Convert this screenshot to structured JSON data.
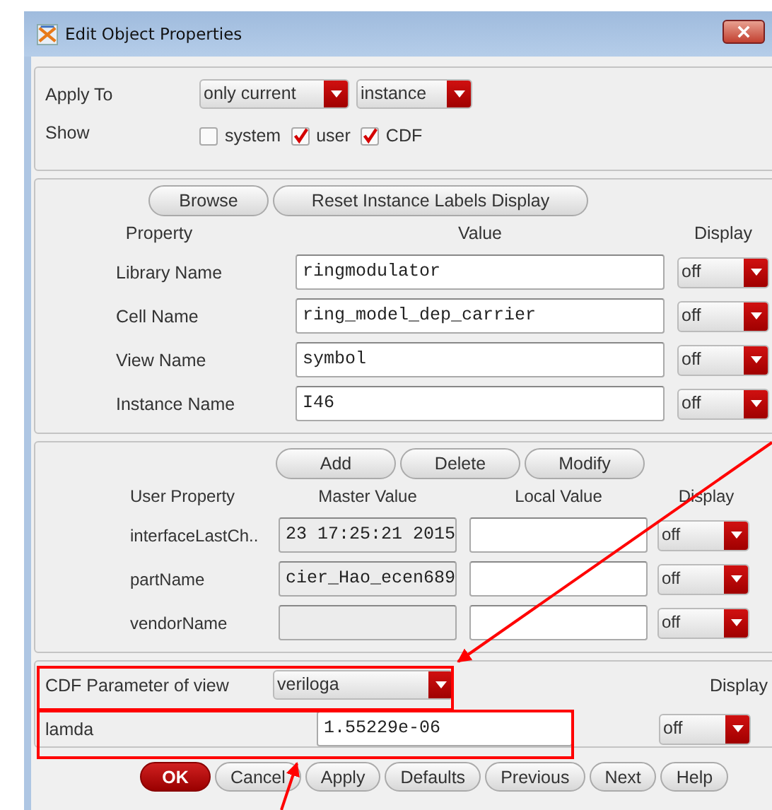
{
  "window": {
    "title": "Edit Object Properties"
  },
  "apply_to": {
    "label": "Apply To",
    "dropdowns": [
      {
        "value": "only current"
      },
      {
        "value": "instance"
      }
    ]
  },
  "show": {
    "label": "Show",
    "options": [
      {
        "label": "system",
        "checked": false
      },
      {
        "label": "user",
        "checked": true
      },
      {
        "label": "CDF",
        "checked": true
      }
    ]
  },
  "properties": {
    "buttons": [
      "Browse",
      "Reset Instance Labels Display"
    ],
    "columns": [
      "Property",
      "Value",
      "Display"
    ],
    "rows": [
      {
        "name": "Library Name",
        "value": "ringmodulator",
        "display": "off"
      },
      {
        "name": "Cell Name",
        "value": "ring_model_dep_carrier",
        "display": "off"
      },
      {
        "name": "View Name",
        "value": "symbol",
        "display": "off"
      },
      {
        "name": "Instance Name",
        "value": "I46",
        "display": "off"
      }
    ]
  },
  "user_properties": {
    "buttons": [
      "Add",
      "Delete",
      "Modify"
    ],
    "columns": [
      "User Property",
      "Master Value",
      "Local Value",
      "Display"
    ],
    "rows": [
      {
        "name": "interfaceLastCh..",
        "master_value": "23 17:25:21 2015",
        "display": "off"
      },
      {
        "name": "partName",
        "master_value": "cier_Hao_ecen689",
        "display": "off"
      },
      {
        "name": "vendorName",
        "display": "off"
      }
    ]
  },
  "cdf": {
    "label": "CDF Parameter of view",
    "view": "veriloga",
    "display_header": "Display",
    "params": [
      {
        "name": "lamda",
        "value": "1.55229e-06",
        "display": "off"
      }
    ]
  },
  "buttons": [
    {
      "label": "OK",
      "kind": "default"
    },
    {
      "label": "Cancel",
      "kind": "normal"
    },
    {
      "label": "Apply",
      "kind": "normal"
    },
    {
      "label": "Defaults",
      "kind": "normal"
    },
    {
      "label": "Previous",
      "kind": "normal"
    },
    {
      "label": "Next",
      "kind": "normal"
    },
    {
      "label": "Help",
      "kind": "normal"
    }
  ]
}
